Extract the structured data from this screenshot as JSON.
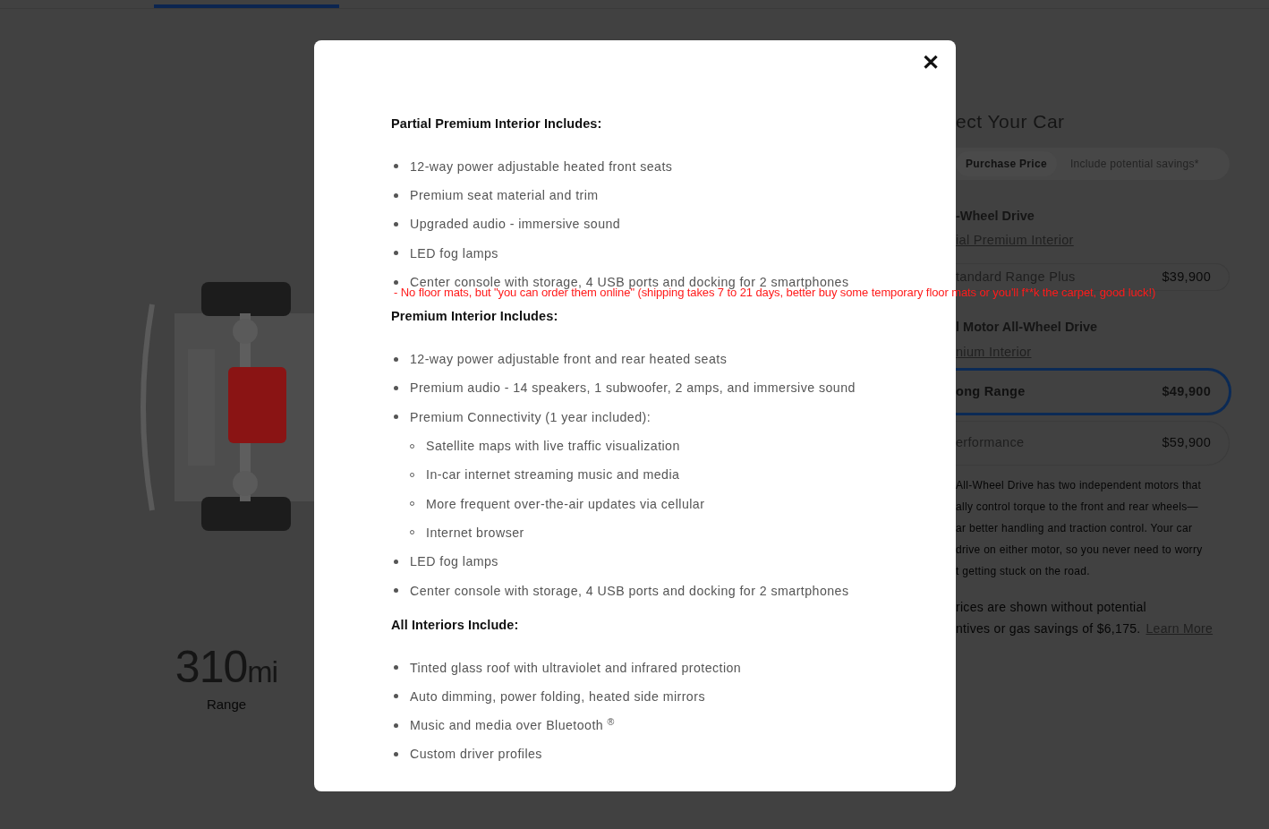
{
  "page": {
    "range": {
      "value": "310",
      "unit": "mi",
      "label": "Range"
    },
    "configurator": {
      "title": "ect Your Car",
      "price_toggle": [
        {
          "label": "Purchase Price",
          "selected": true
        },
        {
          "label": "Include potential savings*",
          "selected": false
        }
      ],
      "groups": [
        {
          "heading": "-Wheel Drive",
          "link": "ial Premium Interior",
          "options": [
            {
              "name": "tandard Range Plus",
              "price": "$39,900",
              "selected": false
            }
          ]
        },
        {
          "heading": "l Motor All-Wheel Drive",
          "link": "nium Interior",
          "options": [
            {
              "name": "ong Range",
              "price": "$49,900",
              "selected": true
            },
            {
              "name": "erformance",
              "price": "$59,900",
              "selected": false
            }
          ]
        }
      ],
      "description_lines": [
        "All-Wheel Drive has two independent motors that",
        "ally control torque to the front and rear wheels—",
        "ar better handling and traction control. Your car",
        "drive on either motor, so you never need to worry",
        "t getting stuck on the road."
      ],
      "note_lines": [
        "rices are shown without potential",
        "ntives or gas savings of $6,175."
      ],
      "note_link": "Learn More"
    }
  },
  "modal": {
    "close": "✕",
    "sections": [
      {
        "heading": "Partial Premium Interior Includes:",
        "items": [
          {
            "text": "12-way power adjustable heated front seats"
          },
          {
            "text": "Premium seat material and trim"
          },
          {
            "text": "Upgraded audio - immersive sound"
          },
          {
            "text": "LED fog lamps"
          },
          {
            "text": "Center console with storage, 4 USB ports and docking for 2 smartphones"
          }
        ]
      },
      {
        "heading": "Premium Interior Includes:",
        "items": [
          {
            "text": "12-way power adjustable front and rear heated seats"
          },
          {
            "text": "Premium audio - 14 speakers, 1 subwoofer, 2 amps, and immersive sound"
          },
          {
            "text": "Premium Connectivity (1 year included):",
            "children": [
              {
                "text": "Satellite maps with live traffic visualization"
              },
              {
                "text": "In-car internet streaming music and media"
              },
              {
                "text": "More frequent over-the-air updates via cellular"
              },
              {
                "text": "Internet browser"
              }
            ]
          },
          {
            "text": "LED fog lamps"
          },
          {
            "text": "Center console with storage, 4 USB ports and docking for 2 smartphones"
          }
        ]
      },
      {
        "heading": "All Interiors Include:",
        "items": [
          {
            "text": "Tinted glass roof with ultraviolet and infrared protection"
          },
          {
            "text": "Auto dimming, power folding, heated side mirrors"
          },
          {
            "text": "Music and media over Bluetooth $^{®}$"
          },
          {
            "text": "Custom driver profiles"
          }
        ]
      }
    ]
  },
  "annotation": "-  No floor mats, but \"you can order them online\" (shipping takes 7 to 21 days, better buy some temporary floor mats or you'll f**k the carpet, good luck!)"
}
